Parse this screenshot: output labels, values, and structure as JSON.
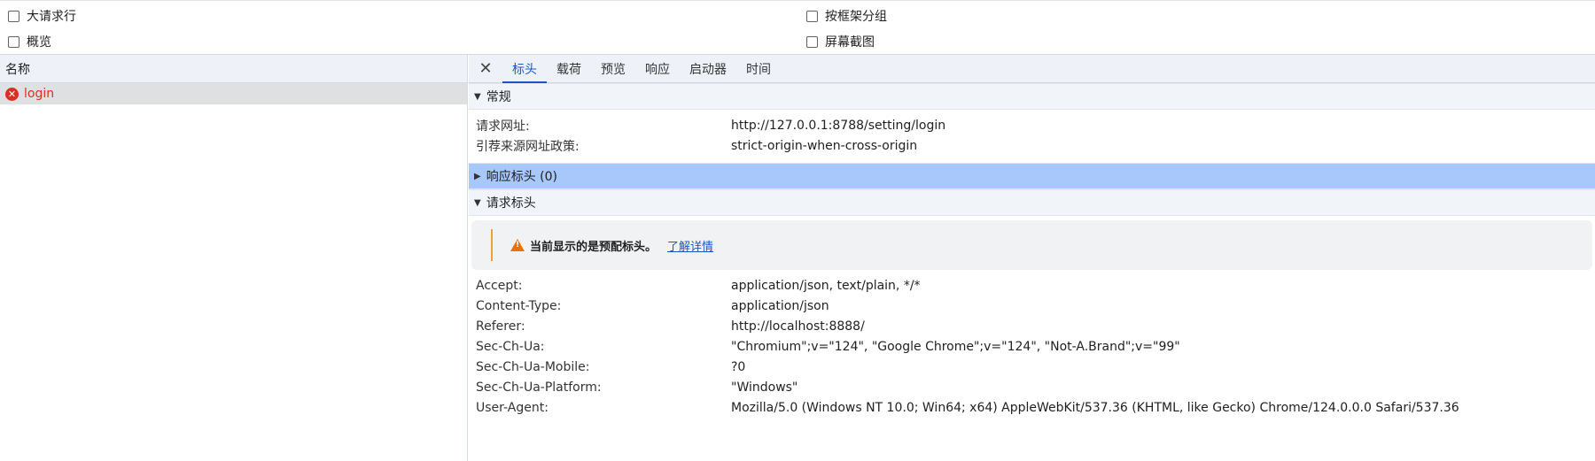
{
  "options": {
    "big_rows": "大请求行",
    "group_by_frame": "按框架分组",
    "overview": "概览",
    "screenshots": "屏幕截图"
  },
  "left": {
    "header": "名称",
    "requests": [
      {
        "name": "login",
        "status": "error"
      }
    ]
  },
  "tabs": [
    "标头",
    "载荷",
    "预览",
    "响应",
    "启动器",
    "时间"
  ],
  "active_tab": "标头",
  "general": {
    "title": "常规",
    "rows": [
      {
        "k": "请求网址:",
        "v": "http://127.0.0.1:8788/setting/login"
      },
      {
        "k": "引荐来源网址政策:",
        "v": "strict-origin-when-cross-origin"
      }
    ]
  },
  "response_headers": {
    "title": "响应标头 (0)"
  },
  "request_headers": {
    "title": "请求标头",
    "warning": "当前显示的是预配标头。",
    "learn_more": "了解详情",
    "rows": [
      {
        "k": "Accept:",
        "v": "application/json, text/plain, */*"
      },
      {
        "k": "Content-Type:",
        "v": "application/json"
      },
      {
        "k": "Referer:",
        "v": "http://localhost:8888/"
      },
      {
        "k": "Sec-Ch-Ua:",
        "v": "\"Chromium\";v=\"124\", \"Google Chrome\";v=\"124\", \"Not-A.Brand\";v=\"99\""
      },
      {
        "k": "Sec-Ch-Ua-Mobile:",
        "v": "?0"
      },
      {
        "k": "Sec-Ch-Ua-Platform:",
        "v": "\"Windows\""
      },
      {
        "k": "User-Agent:",
        "v": "Mozilla/5.0 (Windows NT 10.0; Win64; x64) AppleWebKit/537.36 (KHTML, like Gecko) Chrome/124.0.0.0 Safari/537.36"
      }
    ]
  },
  "colors": {
    "accent": "#1a56c4",
    "error": "#d93025",
    "highlight": "#a8c7fa",
    "warning": "#e8710a"
  }
}
